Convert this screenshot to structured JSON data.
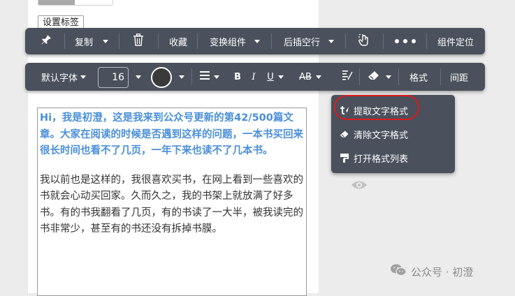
{
  "top": {
    "tag_button": "设置标签"
  },
  "toolbar1": {
    "pin_icon": "pin-icon",
    "copy": "复制",
    "delete_icon": "trash-icon",
    "favorite": "收藏",
    "transform": "变换组件",
    "insert_after": "后插空行",
    "pointer_icon": "hand-pointer-icon",
    "more_icon": "more-dots-icon",
    "locate": "组件定位"
  },
  "toolbar2": {
    "font_family": "默认字体",
    "font_size": "16",
    "color": "#3a3a3a",
    "align_icon": "align-icon",
    "bold": "B",
    "italic": "I",
    "underline": "U",
    "strike": "AB",
    "clear_format_icon": "clear-format-icon",
    "eraser_icon": "eraser-icon",
    "format": "格式",
    "spacing": "间距"
  },
  "dropdown": {
    "items": [
      {
        "label": "提取文字格式",
        "icon": "extract-format-icon"
      },
      {
        "label": "清除文字格式",
        "icon": "eraser-icon"
      },
      {
        "label": "打开格式列表",
        "icon": "format-painter-icon"
      }
    ],
    "highlight_color": "#e11a1a"
  },
  "content": {
    "paragraph1": "Hi，我是初澄，这是我来到公众号更新的第42/500篇文章。大家在阅读的时候是否遇到这样的问题，一本书买回来很长时间也看不了几页，一年下来也读不了几本书。",
    "paragraph2": "我以前也是这样的，我很喜欢买书，在网上看到一些喜欢的书就会心动买回家。久而久之，我的书架上就放满了好多书。有的书我翻看了几页，有的书读了一大半，被我读完的书非常少，甚至有的书还没有拆掉书膜。",
    "accent_color": "#4a8fd8"
  },
  "watermark": {
    "text": "公众号 · 初澄"
  }
}
